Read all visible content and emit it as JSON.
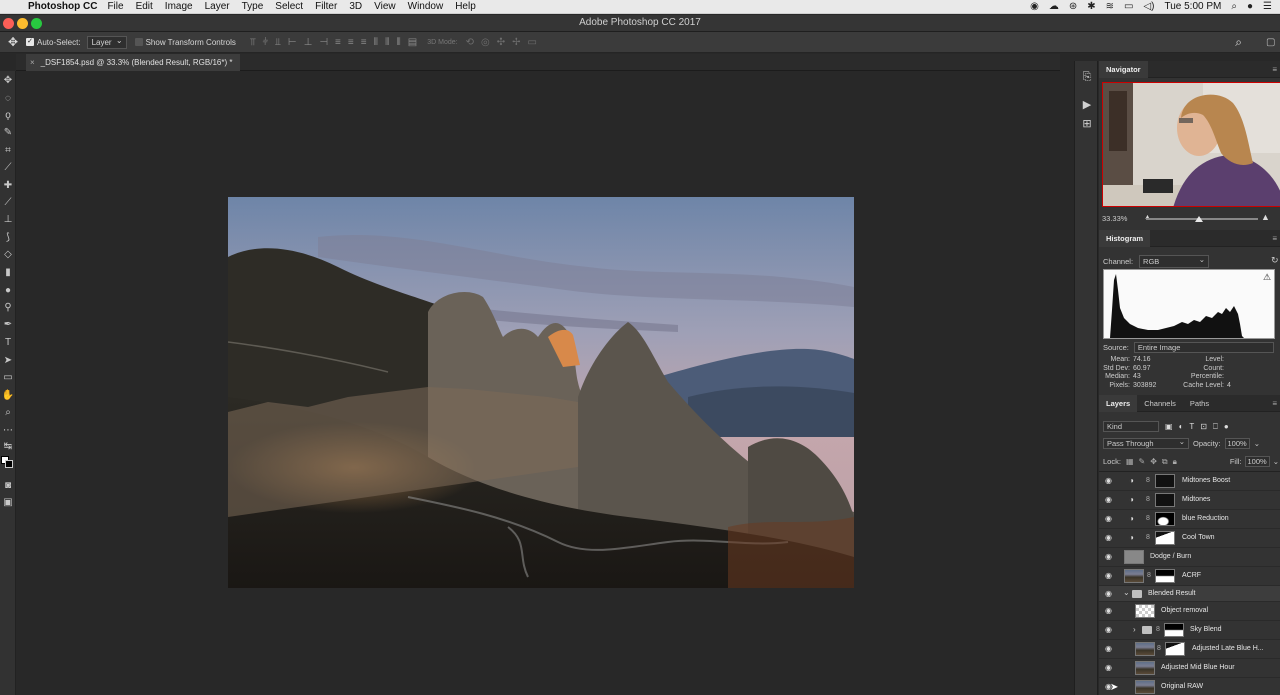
{
  "menubar": {
    "app_name": "Photoshop CC",
    "items": [
      "File",
      "Edit",
      "Image",
      "Layer",
      "Type",
      "Select",
      "Filter",
      "3D",
      "View",
      "Window",
      "Help"
    ],
    "clock": "Tue 5:00 PM"
  },
  "window": {
    "title": "Adobe Photoshop CC 2017"
  },
  "options": {
    "auto_select_label": "Auto-Select:",
    "auto_select_target": "Layer",
    "transform_label": "Show Transform Controls",
    "mode_3d_label": "3D Mode:"
  },
  "document": {
    "tab_label": "_DSF1854.psd @ 33.3% (Blended Result, RGB/16*) *"
  },
  "navigator": {
    "tab": "Navigator",
    "zoom": "33.33%"
  },
  "histogram": {
    "tab": "Histogram",
    "channel_label": "Channel:",
    "channel_value": "RGB",
    "source_label": "Source:",
    "source_value": "Entire Image",
    "stats": {
      "mean_label": "Mean:",
      "mean": "74.16",
      "std_label": "Std Dev:",
      "std": "60.97",
      "median_label": "Median:",
      "median": "43",
      "pixels_label": "Pixels:",
      "pixels": "303892",
      "level_label": "Level:",
      "count_label": "Count:",
      "percentile_label": "Percentile:",
      "cache_label": "Cache Level:",
      "cache": "4"
    }
  },
  "layers": {
    "tabs": [
      "Layers",
      "Channels",
      "Paths"
    ],
    "filter_kind": "Kind",
    "blend_mode": "Pass Through",
    "opacity_label": "Opacity:",
    "opacity": "100%",
    "lock_label": "Lock:",
    "fill_label": "Fill:",
    "fill": "100%",
    "items": [
      {
        "name": "Midtones Boost"
      },
      {
        "name": "Midtones"
      },
      {
        "name": "blue Reduction"
      },
      {
        "name": "Cool Town"
      },
      {
        "name": "Dodge / Burn"
      },
      {
        "name": "ACRF"
      },
      {
        "name": "Blended Result"
      },
      {
        "name": "Object removal"
      },
      {
        "name": "Sky Blend"
      },
      {
        "name": "Adjusted Late Blue H..."
      },
      {
        "name": "Adjusted Mid Blue Hour"
      },
      {
        "name": "Original RAW"
      }
    ]
  }
}
